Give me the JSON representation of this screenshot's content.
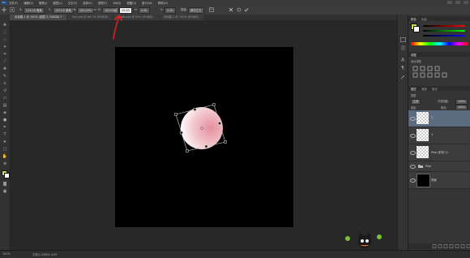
{
  "app": {
    "logo": "Ps"
  },
  "menubar": {
    "items": [
      "文件(F)",
      "编辑(E)",
      "图像(I)",
      "图层(L)",
      "文字(Y)",
      "选择(S)",
      "滤镜(T)",
      "3D(D)",
      "视图(V)",
      "窗口(W)",
      "帮助(H)"
    ]
  },
  "options": {
    "x_label": "X:",
    "x_value": "219.00 像素",
    "y_label": "Y:",
    "y_value": "155.00 像素",
    "w_label": "W:",
    "w_value": "100.00%",
    "h_label": "H:",
    "h_value": "100.00%",
    "angle_value": "15.00",
    "h_skew_label": "H:",
    "h_skew_value": "0.00",
    "v_skew_label": "V:",
    "v_skew_value": "0.00",
    "interp_label": "插值:",
    "interp_value": "两次立方"
  },
  "tabs": [
    {
      "label": "未标题-1 @ 100% (图层 3, RGB/8) *",
      "active": true
    },
    {
      "label": "lion.psd @ 66.7% (RGB/8)",
      "active": false
    },
    {
      "label": "psd6.psd @ 50% (RGB/8)",
      "active": false
    },
    {
      "label": "未标题-2 @ 100% (RGB/8)",
      "active": false
    }
  ],
  "color_panel": {
    "tab1": "颜色",
    "tab2": "色板"
  },
  "adjustments_panel": {
    "title": "调整",
    "subtitle": "添加调整"
  },
  "layers_panel": {
    "tab1": "图层",
    "tab2": "通道",
    "tab3": "路径",
    "filter_label": "类型",
    "blend_mode": "正常",
    "opacity_label": "不透明度:",
    "opacity_value": "100%",
    "lock_label": "锁定:",
    "fill_label": "填充:",
    "fill_value": "100%",
    "layers": [
      {
        "name": "2",
        "selected": true
      },
      {
        "name": "1",
        "selected": false
      },
      {
        "name": "Pink (形状 2)",
        "selected": false
      },
      {
        "name": "Pink",
        "selected": false
      },
      {
        "name": "背景",
        "selected": false
      }
    ]
  },
  "status": {
    "zoom": "100%",
    "doc": "文档:1.26M/2.41M"
  },
  "colors": {
    "accent": "#5b6b80",
    "annotation": "#e02020",
    "circle_pink": "#e8a8b0"
  },
  "icons": [
    "move-tool-icon",
    "marquee-tool-icon",
    "lasso-tool-icon",
    "crop-tool-icon",
    "brush-tool-icon",
    "type-tool-icon",
    "eye-icon",
    "cancel-transform-icon",
    "commit-transform-icon"
  ]
}
